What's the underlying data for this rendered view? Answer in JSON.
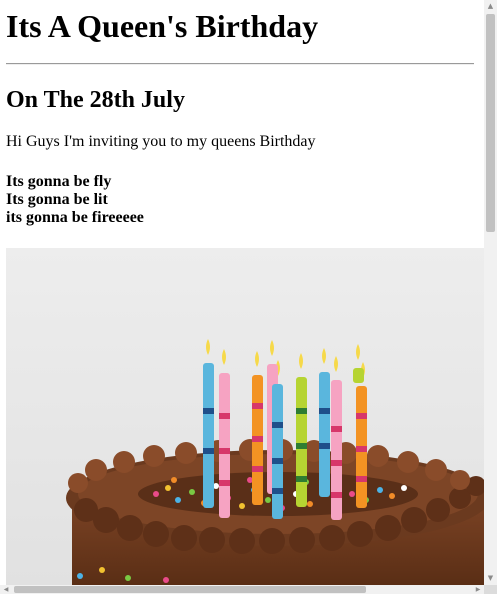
{
  "page": {
    "title": "Its A Queen's Birthday",
    "date_heading": "On The 28th July",
    "intro": "Hi Guys I'm inviting you to my queens Birthday",
    "lines": [
      "Its gonna be fly",
      "Its gonna be lit",
      "its gonna be fireeeee"
    ]
  },
  "image": {
    "subject": "chocolate-birthday-cake-with-candles"
  },
  "scrollbars": {
    "vertical_position": 0,
    "horizontal_position": 0
  },
  "colors": {
    "frosting": "#6b3a1f",
    "background": "#e8e8e8"
  }
}
